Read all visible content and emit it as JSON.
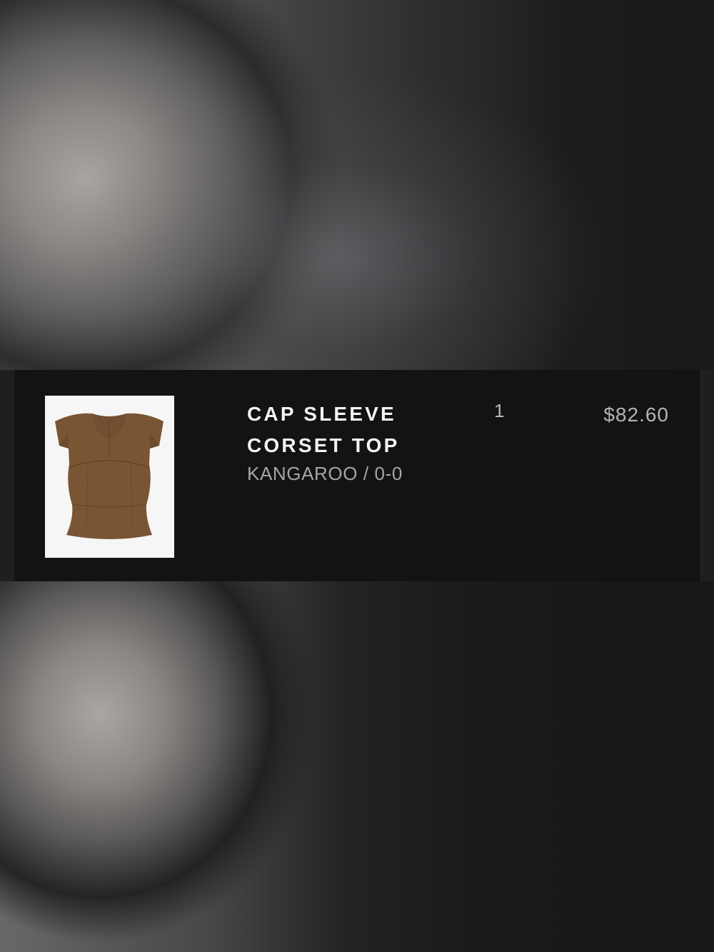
{
  "order_item": {
    "title": "CAP SLEEVE CORSET TOP",
    "variant": "KANGAROO / 0-0",
    "quantity": "1",
    "price": "$82.60",
    "product_color": "#7a5534"
  }
}
